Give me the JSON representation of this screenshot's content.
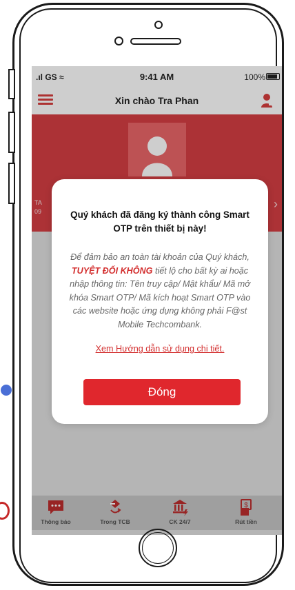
{
  "status_bar": {
    "carrier": ".ıl GS ≈",
    "time": "9:41 AM",
    "battery": "100%"
  },
  "header": {
    "title": "Xin chào Tra Phan"
  },
  "hero": {
    "side_text_1": "TA",
    "side_text_2": "09"
  },
  "modal": {
    "title": "Quý khách đã đăng ký thành công Smart OTP trên thiết bị này!",
    "body_part1": "Để đảm bảo an toàn tài khoản của Quý khách,",
    "body_highlight": "TUYỆT ĐỐI KHÔNG",
    "body_part2": " tiết lộ cho bất kỳ ai hoặc nhập thông tin: Tên truy cập/ Mật khẩu/ Mã mở khóa Smart OTP/ Mã kích hoạt Smart OTP vào các website hoặc ứng dụng không phải F@st Mobile Techcombank.",
    "link": "Xem Hướng dẫn sử dụng chi tiết.",
    "button": "Đóng"
  },
  "bottom_nav": [
    {
      "label": "Thông báo",
      "icon": "chat-icon"
    },
    {
      "label": "Trong TCB",
      "icon": "transfer-icon"
    },
    {
      "label": "CK 24/7",
      "icon": "bank-icon"
    },
    {
      "label": "Rút tiền",
      "icon": "withdraw-icon"
    }
  ],
  "colors": {
    "brand_red": "#d22f35",
    "button_red": "#e0272d"
  }
}
